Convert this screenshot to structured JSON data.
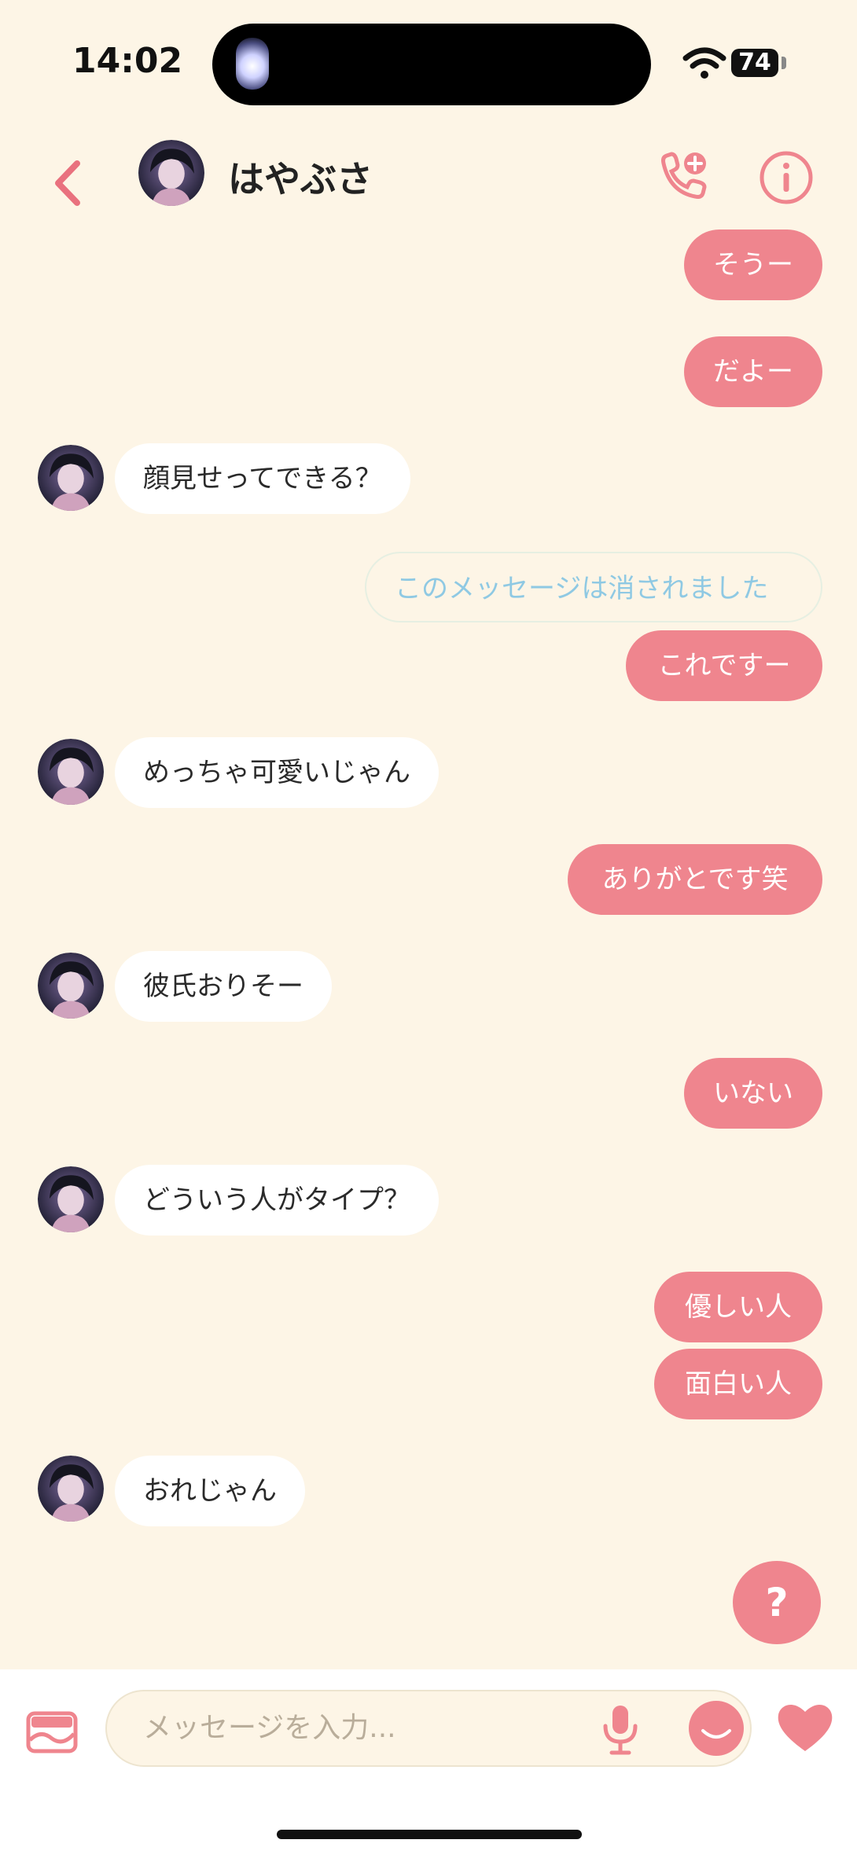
{
  "status_bar": {
    "time": "14:02",
    "battery": "74"
  },
  "header": {
    "contact_name": "はやぶさ",
    "back_icon": "chevron-left-icon",
    "call_icon": "phone-plus-icon",
    "info_icon": "info-icon"
  },
  "messages": [
    {
      "side": "out",
      "text": "そうー"
    },
    {
      "side": "out",
      "text": "だよー"
    },
    {
      "side": "in",
      "text": "顔見せってできる？"
    },
    {
      "side": "deleted",
      "text": "このメッセージは消されました"
    },
    {
      "side": "out",
      "text": "これですー"
    },
    {
      "side": "in",
      "text": "めっちゃ可愛いじゃん"
    },
    {
      "side": "out",
      "text": "ありがとです笑"
    },
    {
      "side": "in",
      "text": "彼氏おりそー"
    },
    {
      "side": "out",
      "text": "いない"
    },
    {
      "side": "in",
      "text": "どういう人がタイプ？"
    },
    {
      "side": "out",
      "text": "優しい人"
    },
    {
      "side": "out",
      "text": "面白い人"
    },
    {
      "side": "in",
      "text": "おれじゃん"
    }
  ],
  "help_button": {
    "label": "?"
  },
  "composer": {
    "placeholder": "メッセージを入力..."
  },
  "colors": {
    "background": "#fdf5e6",
    "accent": "#ef858e",
    "deleted_text": "#8fc9e3"
  }
}
